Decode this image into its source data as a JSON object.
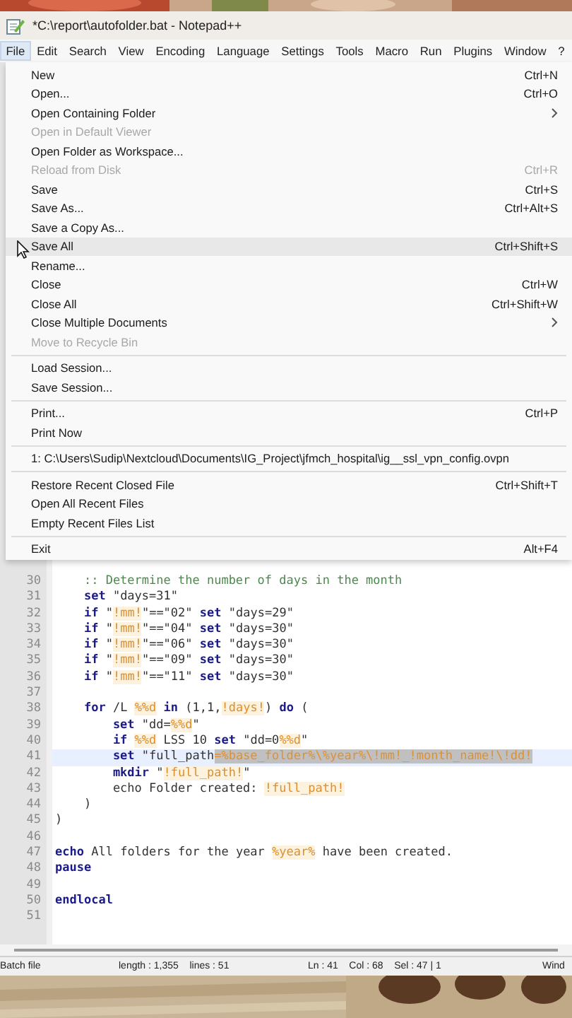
{
  "window": {
    "title": "*C:\\report\\autofolder.bat - Notepad++"
  },
  "menu_bar": [
    {
      "label": "File",
      "selected": true
    },
    {
      "label": "Edit",
      "selected": false
    },
    {
      "label": "Search",
      "selected": false
    },
    {
      "label": "View",
      "selected": false
    },
    {
      "label": "Encoding",
      "selected": false
    },
    {
      "label": "Language",
      "selected": false
    },
    {
      "label": "Settings",
      "selected": false
    },
    {
      "label": "Tools",
      "selected": false
    },
    {
      "label": "Macro",
      "selected": false
    },
    {
      "label": "Run",
      "selected": false
    },
    {
      "label": "Plugins",
      "selected": false
    },
    {
      "label": "Window",
      "selected": false
    },
    {
      "label": "?",
      "selected": false
    }
  ],
  "file_menu": {
    "sections": [
      [
        {
          "label": "New",
          "shortcut": "Ctrl+N",
          "disabled": false,
          "submenu": false,
          "selected": false
        },
        {
          "label": "Open...",
          "shortcut": "Ctrl+O",
          "disabled": false,
          "submenu": false,
          "selected": false
        },
        {
          "label": "Open Containing Folder",
          "disabled": false,
          "submenu": true,
          "selected": false
        },
        {
          "label": "Open in Default Viewer",
          "disabled": true,
          "submenu": false,
          "selected": false
        },
        {
          "label": "Open Folder as Workspace...",
          "disabled": false,
          "submenu": false,
          "selected": false
        },
        {
          "label": "Reload from Disk",
          "shortcut": "Ctrl+R",
          "disabled": true,
          "submenu": false,
          "selected": false
        },
        {
          "label": "Save",
          "shortcut": "Ctrl+S",
          "disabled": false,
          "submenu": false,
          "selected": false
        },
        {
          "label": "Save As...",
          "shortcut": "Ctrl+Alt+S",
          "disabled": false,
          "submenu": false,
          "selected": false
        },
        {
          "label": "Save a Copy As...",
          "disabled": false,
          "submenu": false,
          "selected": false
        },
        {
          "label": "Save All",
          "shortcut": "Ctrl+Shift+S",
          "disabled": false,
          "submenu": false,
          "selected": true
        },
        {
          "label": "Rename...",
          "disabled": false,
          "submenu": false,
          "selected": false
        },
        {
          "label": "Close",
          "shortcut": "Ctrl+W",
          "disabled": false,
          "submenu": false,
          "selected": false
        },
        {
          "label": "Close All",
          "shortcut": "Ctrl+Shift+W",
          "disabled": false,
          "submenu": false,
          "selected": false
        },
        {
          "label": "Close Multiple Documents",
          "disabled": false,
          "submenu": true,
          "selected": false
        },
        {
          "label": "Move to Recycle Bin",
          "disabled": true,
          "submenu": false,
          "selected": false
        }
      ],
      [
        {
          "label": "Load Session...",
          "disabled": false,
          "submenu": false,
          "selected": false
        },
        {
          "label": "Save Session...",
          "disabled": false,
          "submenu": false,
          "selected": false
        }
      ],
      [
        {
          "label": "Print...",
          "shortcut": "Ctrl+P",
          "disabled": false,
          "submenu": false,
          "selected": false
        },
        {
          "label": "Print Now",
          "disabled": false,
          "submenu": false,
          "selected": false
        }
      ],
      [
        {
          "label": "1: C:\\Users\\Sudip\\Nextcloud\\Documents\\IG_Project\\jfmch_hospital\\ig__ssl_vpn_config.ovpn",
          "disabled": false,
          "submenu": false,
          "selected": false
        }
      ],
      [
        {
          "label": "Restore Recent Closed File",
          "shortcut": "Ctrl+Shift+T",
          "disabled": false,
          "submenu": false,
          "selected": false
        },
        {
          "label": "Open All Recent Files",
          "disabled": false,
          "submenu": false,
          "selected": false
        },
        {
          "label": "Empty Recent Files List",
          "disabled": false,
          "submenu": false,
          "selected": false
        }
      ],
      [
        {
          "label": "Exit",
          "shortcut": "Alt+F4",
          "disabled": false,
          "submenu": false,
          "selected": false
        }
      ]
    ]
  },
  "editor": {
    "lines": [
      {
        "number": "30",
        "current": false,
        "segments": [
          {
            "text": "    :: Determine the number of days in the month",
            "kind": "comment"
          }
        ]
      },
      {
        "number": "31",
        "current": false,
        "segments": [
          {
            "text": "    set",
            "kind": "keyword"
          },
          {
            "text": " \"days=31\"",
            "kind": "text"
          }
        ]
      },
      {
        "number": "32",
        "current": false,
        "segments": [
          {
            "text": "    if",
            "kind": "keyword"
          },
          {
            "text": " \"",
            "kind": "text"
          },
          {
            "text": "!mm!",
            "kind": "variable"
          },
          {
            "text": "\"==\"02\" ",
            "kind": "text"
          },
          {
            "text": "set",
            "kind": "keyword"
          },
          {
            "text": " \"days=29\"",
            "kind": "text"
          }
        ]
      },
      {
        "number": "33",
        "current": false,
        "segments": [
          {
            "text": "    if",
            "kind": "keyword"
          },
          {
            "text": " \"",
            "kind": "text"
          },
          {
            "text": "!mm!",
            "kind": "variable"
          },
          {
            "text": "\"==\"04\" ",
            "kind": "text"
          },
          {
            "text": "set",
            "kind": "keyword"
          },
          {
            "text": " \"days=30\"",
            "kind": "text"
          }
        ]
      },
      {
        "number": "34",
        "current": false,
        "segments": [
          {
            "text": "    if",
            "kind": "keyword"
          },
          {
            "text": " \"",
            "kind": "text"
          },
          {
            "text": "!mm!",
            "kind": "variable"
          },
          {
            "text": "\"==\"06\" ",
            "kind": "text"
          },
          {
            "text": "set",
            "kind": "keyword"
          },
          {
            "text": " \"days=30\"",
            "kind": "text"
          }
        ]
      },
      {
        "number": "35",
        "current": false,
        "segments": [
          {
            "text": "    if",
            "kind": "keyword"
          },
          {
            "text": " \"",
            "kind": "text"
          },
          {
            "text": "!mm!",
            "kind": "variable"
          },
          {
            "text": "\"==\"09\" ",
            "kind": "text"
          },
          {
            "text": "set",
            "kind": "keyword"
          },
          {
            "text": " \"days=30\"",
            "kind": "text"
          }
        ]
      },
      {
        "number": "36",
        "current": false,
        "segments": [
          {
            "text": "    if",
            "kind": "keyword"
          },
          {
            "text": " \"",
            "kind": "text"
          },
          {
            "text": "!mm!",
            "kind": "variable"
          },
          {
            "text": "\"==\"11\" ",
            "kind": "text"
          },
          {
            "text": "set",
            "kind": "keyword"
          },
          {
            "text": " \"days=30\"",
            "kind": "text"
          }
        ]
      },
      {
        "number": "37",
        "current": false
      },
      {
        "number": "38",
        "current": false,
        "segments": [
          {
            "text": "    for",
            "kind": "keyword"
          },
          {
            "text": " /L ",
            "kind": "text"
          },
          {
            "text": "%%d",
            "kind": "variable"
          },
          {
            "text": " in",
            "kind": "keyword"
          },
          {
            "text": " (1,1,",
            "kind": "text"
          },
          {
            "text": "!days!",
            "kind": "variable"
          },
          {
            "text": ") ",
            "kind": "text"
          },
          {
            "text": "do",
            "kind": "keyword"
          },
          {
            "text": " (",
            "kind": "text"
          }
        ]
      },
      {
        "number": "39",
        "current": false,
        "segments": [
          {
            "text": "        set",
            "kind": "keyword"
          },
          {
            "text": " \"dd=",
            "kind": "text"
          },
          {
            "text": "%%d",
            "kind": "variable"
          },
          {
            "text": "\"",
            "kind": "text"
          }
        ]
      },
      {
        "number": "40",
        "current": false,
        "segments": [
          {
            "text": "        if ",
            "kind": "keyword"
          },
          {
            "text": "%%d",
            "kind": "variable"
          },
          {
            "text": " LSS 10 ",
            "kind": "text"
          },
          {
            "text": "set",
            "kind": "keyword"
          },
          {
            "text": " \"dd=0",
            "kind": "text"
          },
          {
            "text": "%%d",
            "kind": "variable"
          },
          {
            "text": "\"",
            "kind": "text"
          }
        ]
      },
      {
        "number": "41",
        "current": true,
        "segments": [
          {
            "text": "        set",
            "kind": "keyword"
          },
          {
            "text": " \"full_path",
            "kind": "text"
          },
          {
            "text": "=%base_folder%\\%year%\\!mm!_!month_name!\\!dd!",
            "kind": "selection"
          }
        ]
      },
      {
        "number": "42",
        "current": false,
        "segments": [
          {
            "text": "        mkdir",
            "kind": "keyword"
          },
          {
            "text": " \"",
            "kind": "text"
          },
          {
            "text": "!full_path!",
            "kind": "variable"
          },
          {
            "text": "\"",
            "kind": "text"
          }
        ]
      },
      {
        "number": "43",
        "current": false,
        "segments": [
          {
            "text": "        echo Folder created: ",
            "kind": "text"
          },
          {
            "text": "!full_path!",
            "kind": "variable"
          }
        ]
      },
      {
        "number": "44",
        "current": false,
        "segments": [
          {
            "text": "    )",
            "kind": "text"
          }
        ]
      },
      {
        "number": "45",
        "current": false,
        "segments": [
          {
            "text": ")",
            "kind": "text"
          }
        ]
      },
      {
        "number": "46",
        "current": false
      },
      {
        "number": "47",
        "current": false,
        "segments": [
          {
            "text": "echo",
            "kind": "keyword"
          },
          {
            "text": " All folders for the year ",
            "kind": "text"
          },
          {
            "text": "%year%",
            "kind": "variable"
          },
          {
            "text": " have been created.",
            "kind": "text"
          }
        ]
      },
      {
        "number": "48",
        "current": false,
        "segments": [
          {
            "text": "pause",
            "kind": "keyword"
          }
        ]
      },
      {
        "number": "49",
        "current": false
      },
      {
        "number": "50",
        "current": false,
        "segments": [
          {
            "text": "endlocal",
            "kind": "keyword"
          }
        ]
      },
      {
        "number": "51",
        "current": false
      }
    ]
  },
  "status_bar": [
    "Batch file",
    "length : 1,355    lines : 51",
    "Ln : 41    Col : 68    Sel : 47 | 1",
    "Wind"
  ]
}
